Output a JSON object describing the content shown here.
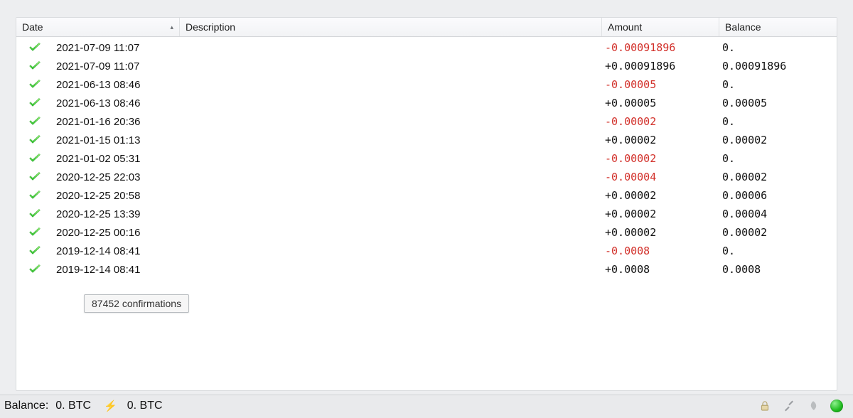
{
  "columns": {
    "date": "Date",
    "description": "Description",
    "amount": "Amount",
    "balance": "Balance",
    "sort_indicator": "▴"
  },
  "transactions": [
    {
      "date": "2021-07-09 11:07",
      "description": "",
      "amount": "-0.00091896",
      "amount_sign": "neg",
      "balance": "0."
    },
    {
      "date": "2021-07-09 11:07",
      "description": "",
      "amount": "+0.00091896",
      "amount_sign": "pos",
      "balance": "0.00091896"
    },
    {
      "date": "2021-06-13 08:46",
      "description": "",
      "amount": "-0.00005",
      "amount_sign": "neg",
      "balance": "0."
    },
    {
      "date": "2021-06-13 08:46",
      "description": "",
      "amount": "+0.00005",
      "amount_sign": "pos",
      "balance": "0.00005"
    },
    {
      "date": "2021-01-16 20:36",
      "description": "",
      "amount": "-0.00002",
      "amount_sign": "neg",
      "balance": "0."
    },
    {
      "date": "2021-01-15 01:13",
      "description": "",
      "amount": "+0.00002",
      "amount_sign": "pos",
      "balance": "0.00002"
    },
    {
      "date": "2021-01-02 05:31",
      "description": "",
      "amount": "-0.00002",
      "amount_sign": "neg",
      "balance": "0."
    },
    {
      "date": "2020-12-25 22:03",
      "description": "",
      "amount": "-0.00004",
      "amount_sign": "neg",
      "balance": "0.00002"
    },
    {
      "date": "2020-12-25 20:58",
      "description": "",
      "amount": "+0.00002",
      "amount_sign": "pos",
      "balance": "0.00006"
    },
    {
      "date": "2020-12-25 13:39",
      "description": "",
      "amount": "+0.00002",
      "amount_sign": "pos",
      "balance": "0.00004"
    },
    {
      "date": "2020-12-25 00:16",
      "description": "",
      "amount": "+0.00002",
      "amount_sign": "pos",
      "balance": "0.00002"
    },
    {
      "date": "2019-12-14 08:41",
      "description": "",
      "amount": "-0.0008",
      "amount_sign": "neg",
      "balance": "0."
    },
    {
      "date": "2019-12-14 08:41",
      "description": "",
      "amount": "+0.0008",
      "amount_sign": "pos",
      "balance": "0.0008"
    }
  ],
  "tooltip": "87452 confirmations",
  "statusbar": {
    "balance_label": "Balance:",
    "balance_value": "0. BTC",
    "lightning_value": "0. BTC"
  },
  "icons": {
    "confirmed": "check-icon",
    "lock": "lock-icon",
    "tools": "tools-icon",
    "seed": "seed-icon",
    "network": "network-status-icon"
  }
}
